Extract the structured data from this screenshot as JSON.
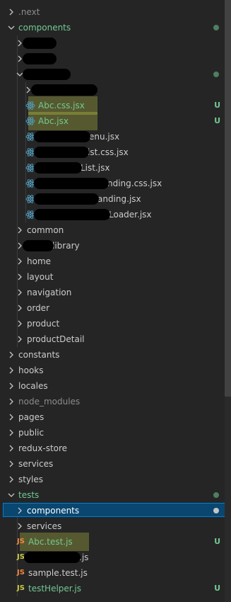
{
  "colors": {
    "background": "#252526",
    "text": "#cccccc",
    "untracked": "#73c991",
    "ignored": "#8c8c8c",
    "selection": "#094771",
    "selection_border": "#007fd4",
    "react_icon": "#519aba",
    "js_icon_yellow": "#cbcb41",
    "js_icon_orange": "#f0883e",
    "highlight": "#d7e34a"
  },
  "explorer": {
    "rows": [
      {
        "label": ".next",
        "depth": 0,
        "kind": "folder",
        "expanded": false,
        "color": "ignored"
      },
      {
        "label": "components",
        "depth": 0,
        "kind": "folder",
        "expanded": true,
        "color": "untracked",
        "dot": true
      },
      {
        "label": "",
        "depth": 1,
        "kind": "folder",
        "expanded": false,
        "redact": [
          48,
          48
        ]
      },
      {
        "label": "",
        "depth": 1,
        "kind": "folder",
        "expanded": false,
        "redact": [
          48,
          48
        ]
      },
      {
        "label": "",
        "depth": 1,
        "kind": "folder",
        "expanded": true,
        "redact": [
          46,
          68
        ],
        "dot": true
      },
      {
        "label": "",
        "depth": 2,
        "kind": "folder",
        "expanded": false,
        "redact": [
          52,
          94
        ]
      },
      {
        "label": "Abc.css.jsx",
        "depth": 2,
        "kind": "react",
        "color": "untracked",
        "badge": "U",
        "highlight": true
      },
      {
        "label": "Abc.jsx",
        "depth": 2,
        "kind": "react",
        "color": "untracked",
        "badge": "U",
        "highlight": true
      },
      {
        "label": "enu.jsx",
        "depth": 2,
        "kind": "react",
        "redact": [
          48,
          80
        ]
      },
      {
        "label": "ist.css.jsx",
        "depth": 2,
        "kind": "react",
        "redact": [
          48,
          78
        ]
      },
      {
        "label": "List.jsx",
        "depth": 2,
        "kind": "react",
        "redact": [
          52,
          68
        ]
      },
      {
        "label": "nding.css.jsx",
        "depth": 2,
        "kind": "react",
        "redact": [
          48,
          106
        ]
      },
      {
        "label": "anding.jsx",
        "depth": 2,
        "kind": "react",
        "redact": [
          48,
          92
        ]
      },
      {
        "label": "Loader.jsx",
        "depth": 2,
        "kind": "react",
        "redact": [
          48,
          108
        ]
      },
      {
        "label": "common",
        "depth": 1,
        "kind": "folder",
        "expanded": false
      },
      {
        "label": "library",
        "depth": 1,
        "kind": "folder",
        "expanded": false,
        "redact": [
          44,
          44
        ]
      },
      {
        "label": "home",
        "depth": 1,
        "kind": "folder",
        "expanded": false
      },
      {
        "label": "layout",
        "depth": 1,
        "kind": "folder",
        "expanded": false
      },
      {
        "label": "navigation",
        "depth": 1,
        "kind": "folder",
        "expanded": false
      },
      {
        "label": "order",
        "depth": 1,
        "kind": "folder",
        "expanded": false
      },
      {
        "label": "product",
        "depth": 1,
        "kind": "folder",
        "expanded": false
      },
      {
        "label": "productDetail",
        "depth": 1,
        "kind": "folder",
        "expanded": false
      },
      {
        "label": "constants",
        "depth": 0,
        "kind": "folder",
        "expanded": false
      },
      {
        "label": "hooks",
        "depth": 0,
        "kind": "folder",
        "expanded": false
      },
      {
        "label": "locales",
        "depth": 0,
        "kind": "folder",
        "expanded": false
      },
      {
        "label": "node_modules",
        "depth": 0,
        "kind": "folder",
        "expanded": false,
        "color": "ignored"
      },
      {
        "label": "pages",
        "depth": 0,
        "kind": "folder",
        "expanded": false
      },
      {
        "label": "public",
        "depth": 0,
        "kind": "folder",
        "expanded": false
      },
      {
        "label": "redux-store",
        "depth": 0,
        "kind": "folder",
        "expanded": false
      },
      {
        "label": "services",
        "depth": 0,
        "kind": "folder",
        "expanded": false
      },
      {
        "label": "styles",
        "depth": 0,
        "kind": "folder",
        "expanded": false
      },
      {
        "label": "tests",
        "depth": 0,
        "kind": "folder",
        "expanded": true,
        "color": "untracked",
        "dot": true
      },
      {
        "label": "components",
        "depth": 1,
        "kind": "folder",
        "expanded": false,
        "selected": true,
        "dot": true
      },
      {
        "label": "services",
        "depth": 1,
        "kind": "folder",
        "expanded": false
      },
      {
        "label": "Abc.test.js",
        "depth": 1,
        "kind": "js",
        "jscolor": "orange",
        "color": "untracked",
        "badge": "U",
        "highlight": true
      },
      {
        "label": ".js",
        "depth": 1,
        "kind": "js",
        "jscolor": "yellow",
        "redact": [
          46,
          80
        ]
      },
      {
        "label": "sample.test.js",
        "depth": 1,
        "kind": "js",
        "jscolor": "orange"
      },
      {
        "label": "testHelper.js",
        "depth": 1,
        "kind": "js",
        "jscolor": "yellow",
        "color": "untracked",
        "badge": "U"
      }
    ]
  }
}
